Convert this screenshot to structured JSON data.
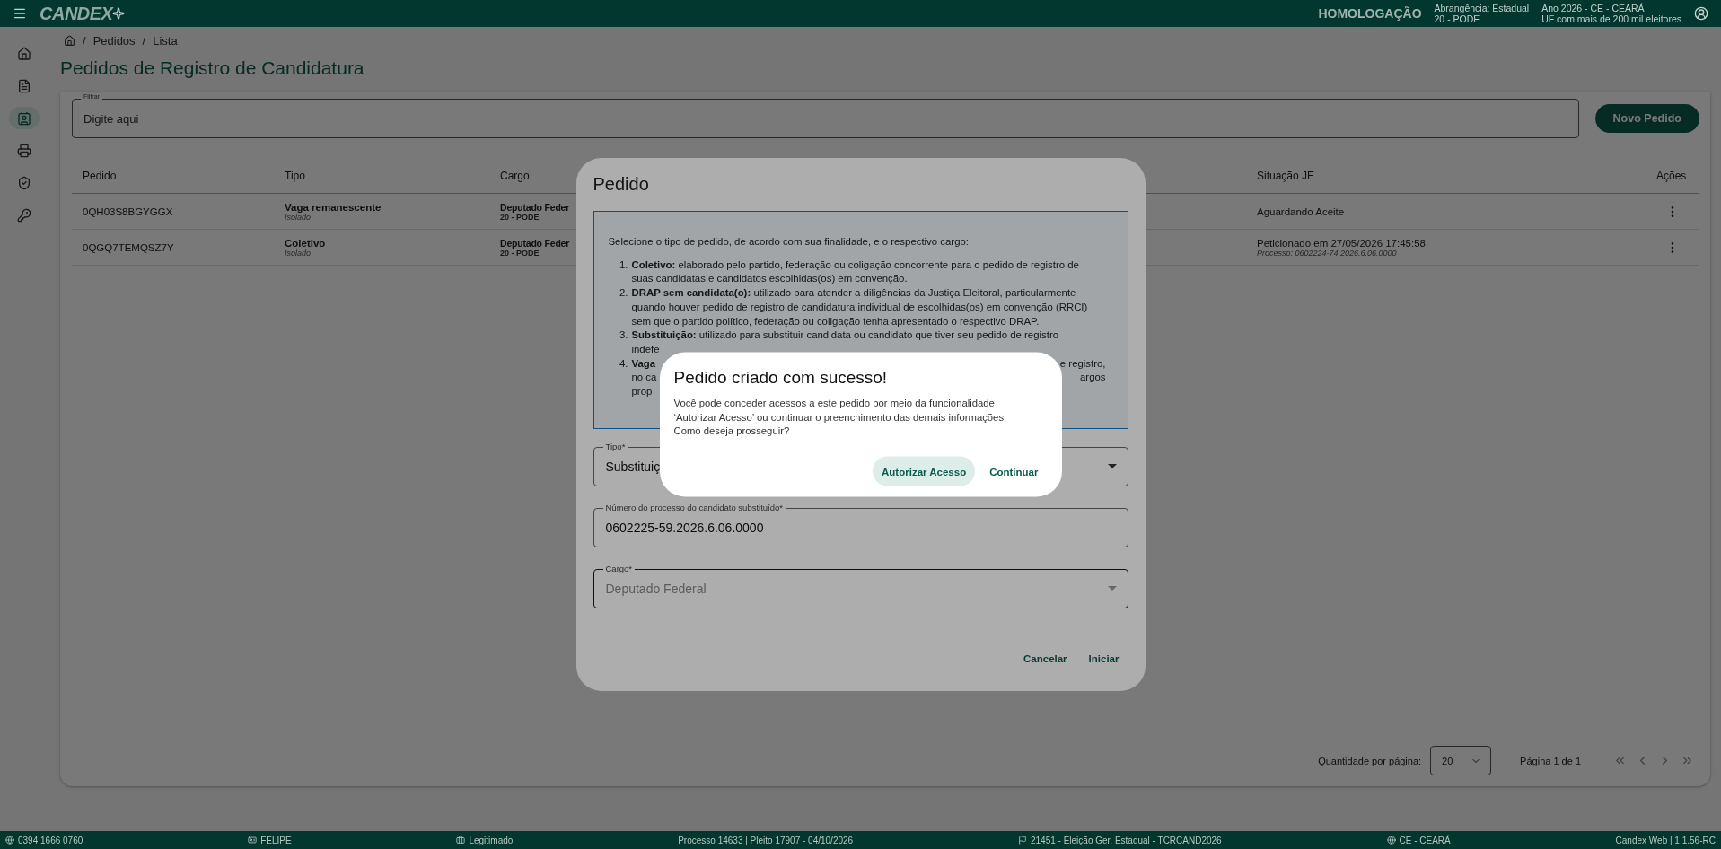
{
  "top_bar": {
    "logo": "CANDEX",
    "environment": "HOMOLOGAÇÃO",
    "scope": [
      "Abrangência: Estadual",
      "20 - PODE"
    ],
    "election": [
      "Ano 2026 - CE - CEARÁ",
      "UF com mais de 200 mil eleitores"
    ]
  },
  "sidebar": {
    "items": [
      {
        "selected": false
      },
      {
        "selected": false
      },
      {
        "selected": true
      },
      {
        "selected": false
      },
      {
        "selected": false
      },
      {
        "selected": false
      }
    ]
  },
  "breadcrumb": {
    "separator": "/",
    "items": [
      "Pedidos",
      "Lista"
    ]
  },
  "page_title": "Pedidos de Registro de Candidatura",
  "filter": {
    "label": "Filtrar",
    "placeholder": "Digite aqui"
  },
  "new_button": "Novo Pedido",
  "table": {
    "columns": [
      "Pedido",
      "Tipo",
      "Cargo",
      "Situação JE",
      "Ações"
    ],
    "rows": [
      {
        "pedido": "0QH03S8BGYGGX",
        "tipo": "Vaga remanescente",
        "tipo_sub": "Isolado",
        "cargo": "Deputado Feder",
        "cargo_sub": "20 - PODE",
        "situacao": "Aguardando Aceite"
      },
      {
        "pedido": "0QGQ7TEMQSZ7Y",
        "tipo": "Coletivo",
        "tipo_sub": "Isolado",
        "cargo": "Deputado Feder",
        "cargo_sub": "20 - PODE",
        "situacao": "Peticionado em 27/05/2026 17:45:58",
        "situacao_sub": "Processo: 0602224-74.2026.6.06.0000"
      }
    ]
  },
  "pagination": {
    "label": "Quantidade por página:",
    "page_size": "20",
    "page_info": "Página 1 de 1"
  },
  "status_bar": [
    {
      "kind": "globe",
      "text": "0394 1666 0760"
    },
    {
      "kind": "badge",
      "text": "FELIPE"
    },
    {
      "kind": "briefcase",
      "text": "Legitimado"
    },
    {
      "kind": "plain",
      "text": "Processo 14633 | Pleito 17907 - 04/10/2026"
    },
    {
      "kind": "flag",
      "text": "21451 - Eleição Ger. Estadual - TCRCAND2026"
    },
    {
      "kind": "globe",
      "text": "CE - CEARÁ"
    },
    {
      "kind": "plain",
      "text": "Candex Web | 1.1.56-RC"
    }
  ],
  "order_dialog": {
    "title": "Pedido",
    "intro": "Selecione o tipo de pedido, de acordo com sua finalidade, e o respectivo cargo:",
    "items": [
      {
        "number": "1.",
        "lines": [
          {
            "text": "**Coletivo:** elaborado pelo partido, federação ou coligação concorrente para o pedido de registro de"
          },
          {
            "text": "suas candidatas e candidatos escolhidas(os) em convenção."
          }
        ]
      },
      {
        "number": "2.",
        "lines": [
          {
            "text": "**DRAP sem candidata(o):** utilizado para atender a diligências da Justiça Eleitoral, particularmente"
          },
          {
            "text": "quando houver pedido de registro de candidatura individual de escolhidas(os) em convenção (RRCI)"
          },
          {
            "text": "sem que o partido político, federação ou coligação tenha apresentado o respectivo DRAP."
          }
        ]
      },
      {
        "number": "3.",
        "lines": [
          {
            "text": "**Substituição:** utilizado para substituir candidata ou candidato que tiver seu pedido de registro"
          },
          {
            "text": "indefe"
          }
        ]
      },
      {
        "number": "4.",
        "lines": [
          {
            "text": "**Vaga**",
            "end": "e registro,"
          },
          {
            "text": "no ca",
            "end": "argos"
          },
          {
            "text": "prop"
          }
        ]
      }
    ],
    "fields": [
      {
        "kind": "select",
        "label": "Tipo*",
        "value": "Substituiç",
        "disabled": false
      },
      {
        "kind": "text",
        "label": "Número do processo do candidato substituído*",
        "value": "0602225-59.2026.6.06.0000",
        "disabled": false
      },
      {
        "kind": "select",
        "label": "Cargo*",
        "value": "Deputado Federal",
        "disabled": true
      }
    ],
    "buttons": [
      "Cancelar",
      "Iniciar"
    ]
  },
  "success_dialog": {
    "title": "Pedido criado com sucesso!",
    "message": [
      "Você pode conceder acessos a este pedido por meio da funcionalidade",
      "‘Autorizar Acesso’ ou continuar o preenchimento das demais informações.",
      "Como deseja prosseguir?"
    ],
    "buttons": [
      {
        "kind": "tonal",
        "label": "Autorizar Acesso"
      },
      {
        "kind": "text",
        "label": "Continuar"
      }
    ]
  }
}
